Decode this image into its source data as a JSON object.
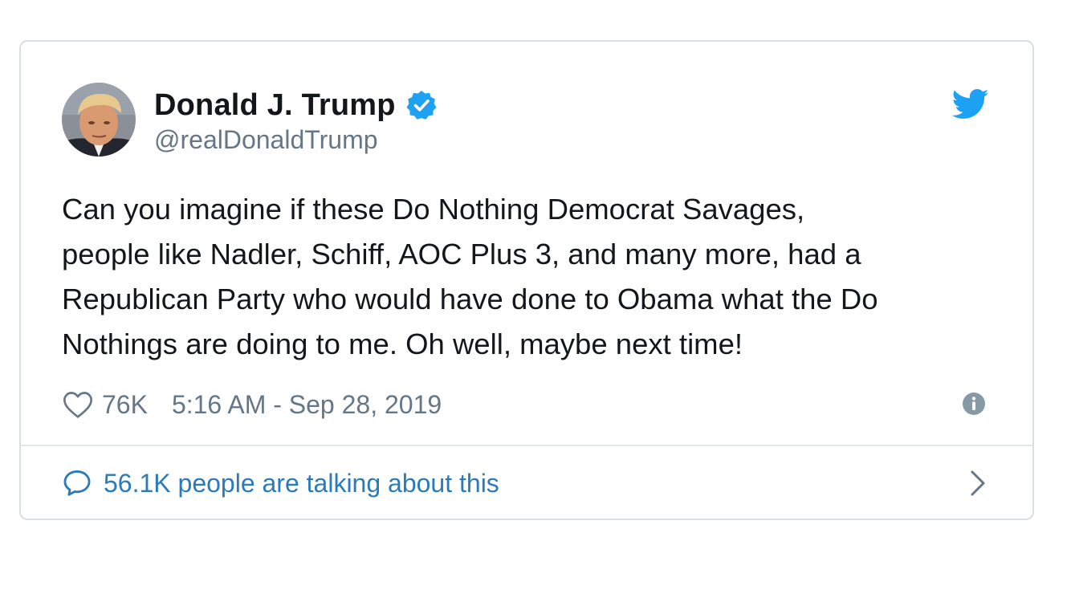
{
  "colors": {
    "text": "#14171a",
    "secondary": "#657786",
    "link": "#2b7bb9",
    "verified": "#1da1f2",
    "border": "#d9dee3"
  },
  "author": {
    "name": "Donald J. Trump",
    "handle": "@realDonaldTrump",
    "avatar_icon": "profile-photo",
    "verified_icon": "verified-badge-icon"
  },
  "brand_icon": "twitter-bird-icon",
  "tweet": {
    "lines": [
      "Can you imagine if these Do Nothing Democrat Savages,",
      "people like Nadler, Schiff, AOC Plus 3, and many more, had a",
      "Republican Party who would have done to Obama what the Do",
      "Nothings are doing to me. Oh well, maybe next time!"
    ]
  },
  "meta": {
    "likes": "76K",
    "timestamp": "5:16 AM - Sep 28, 2019",
    "like_icon": "heart-icon",
    "info_icon": "info-icon"
  },
  "conversation": {
    "label": "56.1K people are talking about this",
    "icon": "speech-bubble-icon",
    "chevron_icon": "chevron-right-icon"
  }
}
